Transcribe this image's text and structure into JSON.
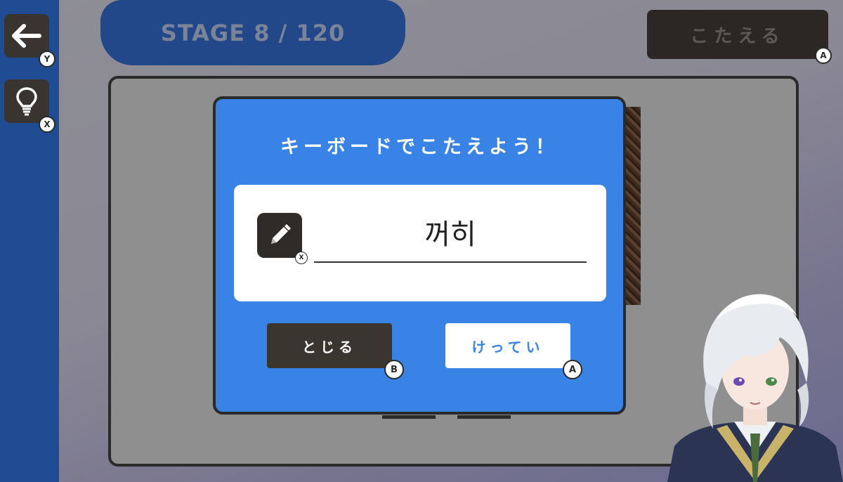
{
  "header": {
    "stage_label": "STAGE 8 / 120",
    "answer_button_label": "こたえる",
    "answer_button_hint": "A"
  },
  "sidebar": {
    "back_button": {
      "icon": "arrow-left-icon",
      "hint": "Y"
    },
    "hint_button": {
      "icon": "lightbulb-icon",
      "hint": "X"
    }
  },
  "dialog": {
    "title": "キーボードでこたえよう！",
    "input_value": "꺼히",
    "edit_icon_hint": "X",
    "close_label": "とじる",
    "close_hint": "B",
    "confirm_label": "けってい",
    "confirm_hint": "A"
  },
  "colors": {
    "sidebar": "#1f4c93",
    "dialog": "#3a83e6",
    "dark_button": "#3b3530",
    "board": "#8f8f8f"
  }
}
